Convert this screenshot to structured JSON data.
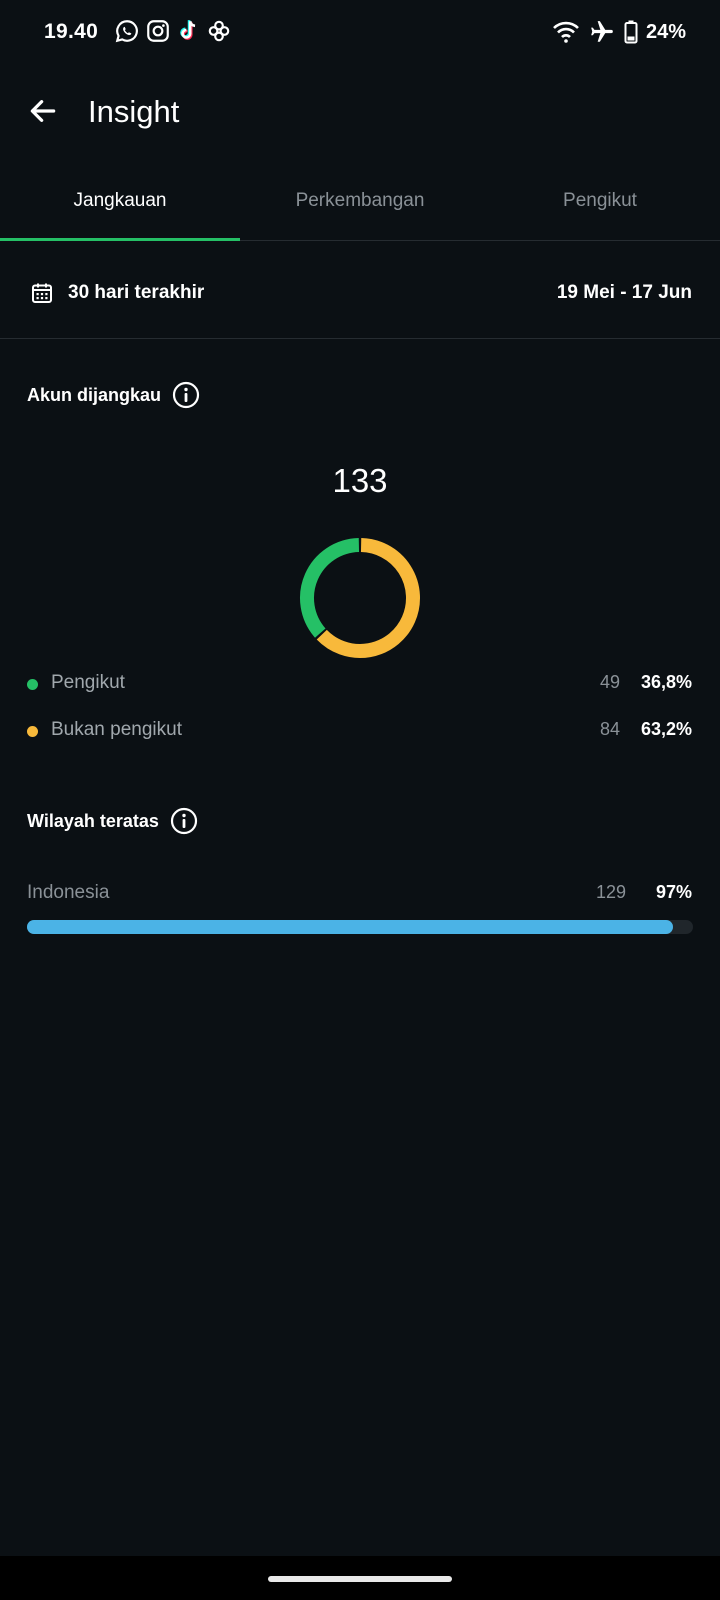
{
  "status_bar": {
    "time": "19.40",
    "notification_icons": [
      "whatsapp-icon",
      "instagram-icon",
      "tiktok-icon",
      "pinwheel-icon"
    ],
    "right_icons": [
      "wifi-icon",
      "airplane-icon",
      "battery-icon"
    ],
    "battery": "24%"
  },
  "app_bar": {
    "back_icon": "arrow-left-icon",
    "title": "Insight"
  },
  "tabs": [
    {
      "label": "Jangkauan",
      "active": true
    },
    {
      "label": "Perkembangan",
      "active": false
    },
    {
      "label": "Pengikut",
      "active": false
    }
  ],
  "date_range": {
    "icon": "calendar-icon",
    "label": "30 hari terakhir",
    "dates": "19 Mei - 17 Jun"
  },
  "accounts_reached": {
    "title": "Akun dijangkau",
    "total": "133",
    "legend": [
      {
        "label": "Pengikut",
        "count": "49",
        "percent": "36,8%",
        "color": "#25c066"
      },
      {
        "label": "Bukan pengikut",
        "count": "84",
        "percent": "63,2%",
        "color": "#f8b93b"
      }
    ]
  },
  "chart_data": {
    "type": "pie",
    "categories": [
      "Pengikut",
      "Bukan pengikut"
    ],
    "values": [
      49,
      84
    ],
    "colors": [
      "#25c066",
      "#f8b93b"
    ]
  },
  "top_regions": {
    "title": "Wilayah teratas",
    "items": [
      {
        "label": "Indonesia",
        "count": "129",
        "percent": "97%",
        "fraction": 0.97,
        "color": "#4bb3e6"
      }
    ]
  }
}
